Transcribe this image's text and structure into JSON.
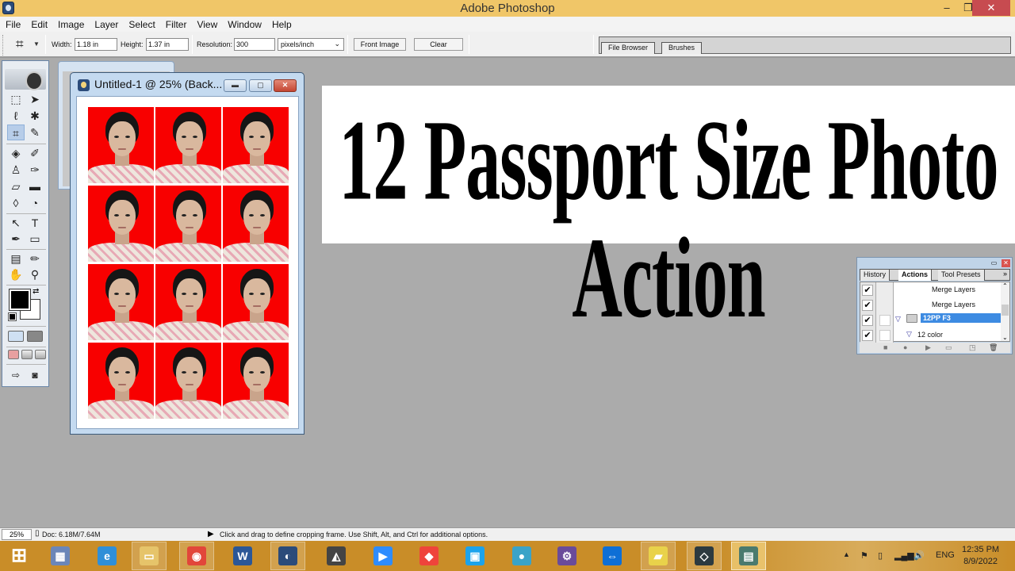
{
  "window": {
    "title": "Adobe Photoshop",
    "min_icon": "minimize-icon",
    "max_icon": "restore-icon",
    "close_icon": "close-icon"
  },
  "menu": [
    "File",
    "Edit",
    "Image",
    "Layer",
    "Select",
    "Filter",
    "View",
    "Window",
    "Help"
  ],
  "options": {
    "tool_icon": "crop-icon",
    "width_label": "Width:",
    "width_value": "1.18 in",
    "height_label": "Height:",
    "height_value": "1.37 in",
    "resolution_label": "Resolution:",
    "resolution_value": "300",
    "resolution_unit": "pixels/inch",
    "front_image_label": "Front Image",
    "clear_label": "Clear",
    "palette_tabs": [
      "File Browser",
      "Brushes"
    ]
  },
  "toolbox": {
    "tools": [
      {
        "name": "marquee-tool",
        "glyph": "⬚"
      },
      {
        "name": "move-tool",
        "glyph": "➤"
      },
      {
        "name": "lasso-tool",
        "glyph": "ℓ"
      },
      {
        "name": "magic-wand-tool",
        "glyph": "✱"
      },
      {
        "name": "crop-tool",
        "glyph": "⌗"
      },
      {
        "name": "slice-tool",
        "glyph": "✎"
      },
      {
        "name": "healing-brush-tool",
        "glyph": "◈"
      },
      {
        "name": "brush-tool",
        "glyph": "✐"
      },
      {
        "name": "clone-stamp-tool",
        "glyph": "♙"
      },
      {
        "name": "history-brush-tool",
        "glyph": "✑"
      },
      {
        "name": "eraser-tool",
        "glyph": "▱"
      },
      {
        "name": "gradient-tool",
        "glyph": "▬"
      },
      {
        "name": "blur-tool",
        "glyph": "💧"
      },
      {
        "name": "dodge-tool",
        "glyph": "◔"
      },
      {
        "name": "path-selection-tool",
        "glyph": "↖"
      },
      {
        "name": "type-tool",
        "glyph": "T"
      },
      {
        "name": "pen-tool",
        "glyph": "✒"
      },
      {
        "name": "shape-tool",
        "glyph": "▭"
      },
      {
        "name": "notes-tool",
        "glyph": "▤"
      },
      {
        "name": "eyedropper-tool",
        "glyph": "✏"
      },
      {
        "name": "hand-tool",
        "glyph": "✋"
      },
      {
        "name": "zoom-tool",
        "glyph": "🔍"
      }
    ],
    "active_tool": "crop-tool",
    "foreground_color": "#000000",
    "background_color": "#ffffff"
  },
  "document": {
    "title": "Untitled-1 @ 25% (Back...",
    "rows": 4,
    "cols": 3,
    "photo_background": "#f80000"
  },
  "banner": {
    "text": "12 Passport Size Photo Action"
  },
  "actions_panel": {
    "tabs": [
      "History",
      "Actions",
      "Tool Presets"
    ],
    "active_tab": "Actions",
    "rows": [
      {
        "checked": true,
        "dialog": false,
        "label": "Merge Layers",
        "indent": 2,
        "type": "step"
      },
      {
        "checked": true,
        "dialog": false,
        "label": "Merge Layers",
        "indent": 2,
        "type": "step"
      },
      {
        "checked": true,
        "dialog": true,
        "label": "12PP F3",
        "indent": 0,
        "type": "set",
        "selected": true
      },
      {
        "checked": true,
        "dialog": true,
        "label": "12 color",
        "indent": 1,
        "type": "action"
      }
    ],
    "bottom_icons": [
      "stop-icon",
      "record-icon",
      "play-icon",
      "new-set-icon",
      "new-action-icon",
      "trash-icon"
    ]
  },
  "status": {
    "zoom": "25%",
    "doc": "Doc: 6.18M/7.64M",
    "hint": "Click and drag to define cropping frame. Use Shift, Alt, and Ctrl for additional options."
  },
  "taskbar": {
    "apps": [
      {
        "name": "start",
        "color": "#ffffff",
        "glyph": "⊞"
      },
      {
        "name": "calculator",
        "color": "#6b86b8",
        "glyph": "▦"
      },
      {
        "name": "internet-explorer",
        "color": "#2f8fd8",
        "glyph": "e"
      },
      {
        "name": "file-explorer",
        "color": "#e6c46a",
        "glyph": "▭"
      },
      {
        "name": "chrome",
        "color": "#e2463a",
        "glyph": "◉"
      },
      {
        "name": "word",
        "color": "#2b5797",
        "glyph": "W"
      },
      {
        "name": "photoshop",
        "color": "#2b4b7a",
        "glyph": "◐"
      },
      {
        "name": "scanner",
        "color": "#444444",
        "glyph": "◭"
      },
      {
        "name": "zoom",
        "color": "#2d8cff",
        "glyph": "▶"
      },
      {
        "name": "anydesk",
        "color": "#ef443b",
        "glyph": "◆"
      },
      {
        "name": "screen-recorder",
        "color": "#1ca3ec",
        "glyph": "▣"
      },
      {
        "name": "rec-app",
        "color": "#3aa3c8",
        "glyph": "●"
      },
      {
        "name": "game-app",
        "color": "#6a4b9a",
        "glyph": "⚙"
      },
      {
        "name": "teamviewer",
        "color": "#0e6fd6",
        "glyph": "⇔"
      },
      {
        "name": "sticky-notes",
        "color": "#e9d24a",
        "glyph": "▰"
      },
      {
        "name": "filmora",
        "color": "#2c3a40",
        "glyph": "◇"
      },
      {
        "name": "active-window",
        "color": "#4a7a6e",
        "glyph": "▤"
      }
    ],
    "language": "ENG",
    "time": "12:35 PM",
    "date": "8/9/2022"
  }
}
